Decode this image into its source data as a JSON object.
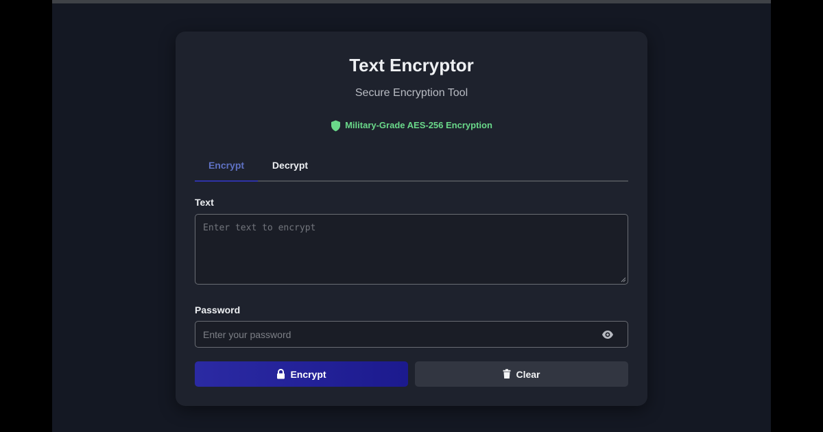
{
  "app": {
    "title": "Text Encryptor",
    "subtitle": "Secure Encryption Tool",
    "badge": "Military-Grade AES-256 Encryption"
  },
  "tabs": [
    {
      "label": "Encrypt",
      "active": true
    },
    {
      "label": "Decrypt",
      "active": false
    }
  ],
  "form": {
    "text_label": "Text",
    "text_placeholder": "Enter text to encrypt",
    "text_value": "",
    "password_label": "Password",
    "password_placeholder": "Enter your password",
    "password_value": ""
  },
  "buttons": {
    "encrypt_label": "Encrypt",
    "clear_label": "Clear"
  },
  "icons": {
    "badge": "shield-icon",
    "password_toggle": "eye-icon",
    "encrypt": "lock-icon",
    "clear": "trash-icon"
  },
  "colors": {
    "accent": "#2b2aa3",
    "badge_green": "#6ad98a",
    "active_tab": "#5f72c4",
    "background": "#141823",
    "card": "#1e222d"
  }
}
